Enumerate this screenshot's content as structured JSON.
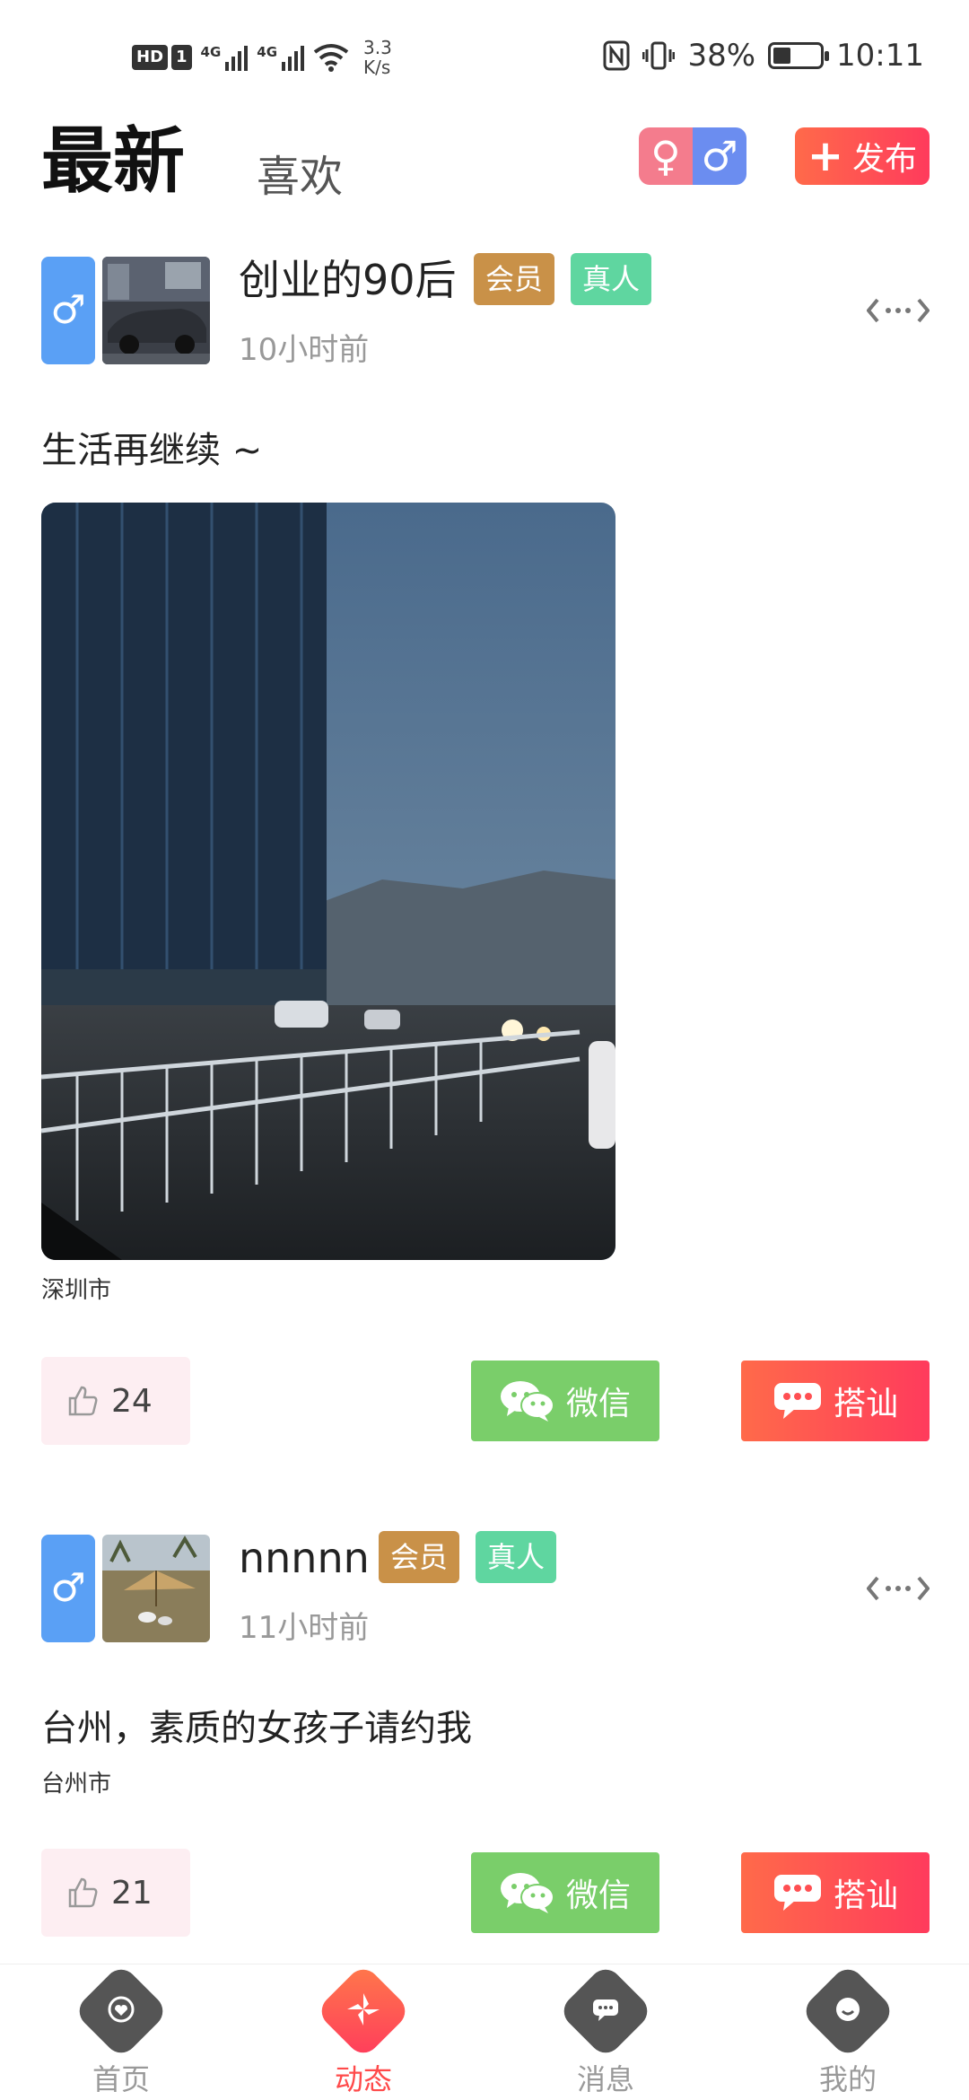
{
  "status_bar": {
    "hd_labels": [
      "HD",
      "1"
    ],
    "network_1": "4G",
    "network_2": "4G",
    "speed_value": "3.3",
    "speed_unit": "K/s",
    "battery_percent": "38%",
    "battery_level": 0.38,
    "time": "10:11"
  },
  "header": {
    "tab_latest": "最新",
    "tab_like": "喜欢",
    "female_symbol": "♀",
    "male_symbol": "♂",
    "publish_label": "发布"
  },
  "posts": [
    {
      "gender_symbol": "♂",
      "username": "创业的90后",
      "badge_vip": "会员",
      "badge_real": "真人",
      "time": "10小时前",
      "content": "生活再继续 ~",
      "location": "深圳市",
      "likes": "24",
      "wechat_label": "微信",
      "chat_label": "搭讪"
    },
    {
      "gender_symbol": "♂",
      "username": "nnnnn",
      "badge_vip": "会员",
      "badge_real": "真人",
      "time": "11小时前",
      "content": "台州，素质的女孩子请约我",
      "location": "台州市",
      "likes": "21",
      "wechat_label": "微信",
      "chat_label": "搭讪"
    }
  ],
  "tabbar": {
    "items": [
      {
        "label": "首页",
        "icon": "home-icon"
      },
      {
        "label": "动态",
        "icon": "feed-icon",
        "active": true
      },
      {
        "label": "消息",
        "icon": "message-icon"
      },
      {
        "label": "我的",
        "icon": "profile-icon"
      }
    ]
  },
  "colors": {
    "accent": "#ff4a4a",
    "male_blue": "#5aa0f5",
    "female_pink": "#f47c8d",
    "wechat_green": "#7ace6a",
    "vip_gold": "#c99148",
    "real_green": "#5fd6a0"
  }
}
